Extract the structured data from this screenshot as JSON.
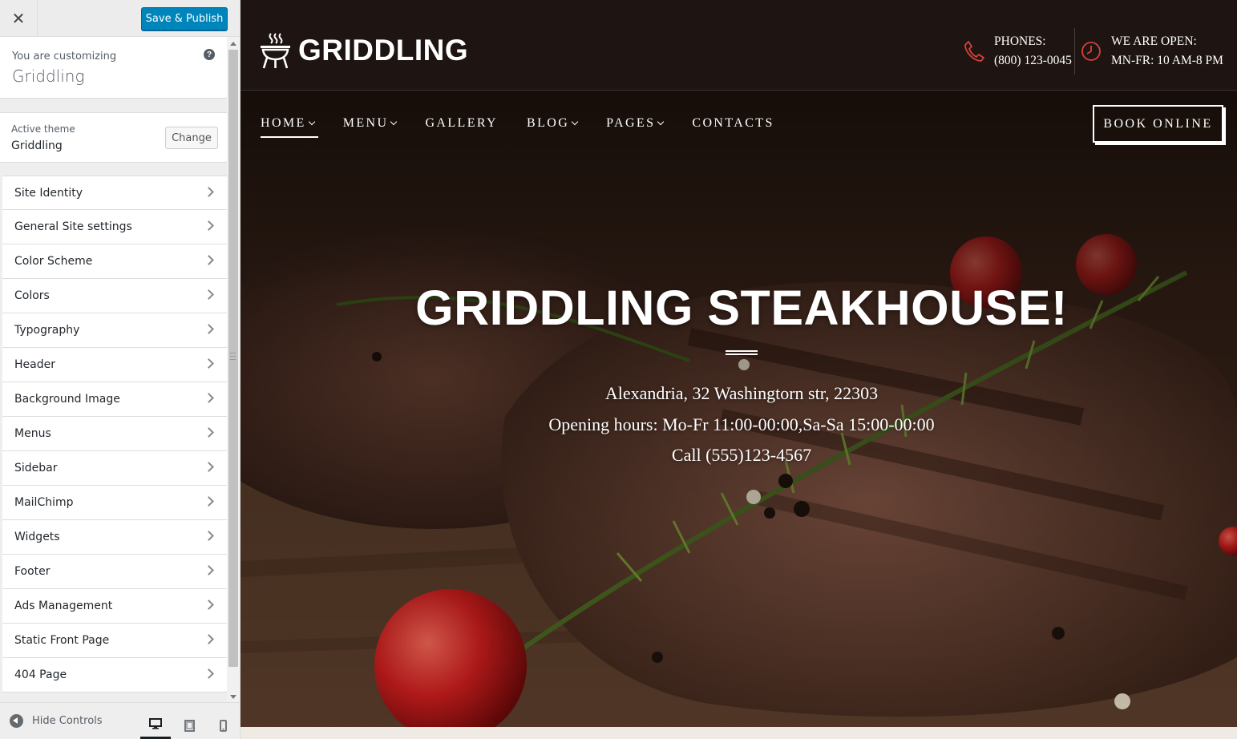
{
  "customizer": {
    "save_label": "Save & Publish",
    "close_glyph": "✕",
    "info": {
      "you_are_customizing": "You are customizing",
      "site_name": "Griddling",
      "help_glyph": "?"
    },
    "active_theme": {
      "label": "Active theme",
      "name": "Griddling",
      "change_label": "Change"
    },
    "panels": [
      {
        "label": "Site Identity"
      },
      {
        "label": "General Site settings"
      },
      {
        "label": "Color Scheme"
      },
      {
        "label": "Colors"
      },
      {
        "label": "Typography"
      },
      {
        "label": "Header"
      },
      {
        "label": "Background Image"
      },
      {
        "label": "Menus"
      },
      {
        "label": "Sidebar"
      },
      {
        "label": "MailChimp"
      },
      {
        "label": "Widgets"
      },
      {
        "label": "Footer"
      },
      {
        "label": "Ads Management"
      },
      {
        "label": "Static Front Page"
      },
      {
        "label": "404 Page"
      }
    ],
    "footer": {
      "hide_controls_label": "Hide Controls",
      "active_device": "desktop"
    },
    "colors": {
      "accent": "#0085ba",
      "panel_bg": "#ffffff",
      "sidebar_bg": "#eeeeee"
    }
  },
  "site": {
    "logo_text": "GRIDDLING",
    "logo_icon": "grill-icon",
    "contacts": {
      "phones_label": "PHONES:",
      "phones_value": "(800) 123-0045",
      "hours_label": "WE ARE OPEN:",
      "hours_value": "MN-FR: 10 AM-8 PM",
      "accent_color": "#d6403b"
    },
    "nav": [
      {
        "label": "HOME",
        "has_dropdown": true,
        "active": true
      },
      {
        "label": "MENU",
        "has_dropdown": true
      },
      {
        "label": "GALLERY",
        "has_dropdown": false
      },
      {
        "label": "BLOG",
        "has_dropdown": true
      },
      {
        "label": "PAGES",
        "has_dropdown": true
      },
      {
        "label": "CONTACTS",
        "has_dropdown": false
      }
    ],
    "book_label": "BOOK ONLINE",
    "hero": {
      "title": "GRIDDLING STEAKHOUSE!",
      "address": "Alexandria, 32 Washingtorn str, 22303",
      "hours": "Opening hours: Mo-Fr 11:00-00:00,Sa-Sa 15:00-00:00",
      "call": "Call (555)123-4567"
    }
  }
}
